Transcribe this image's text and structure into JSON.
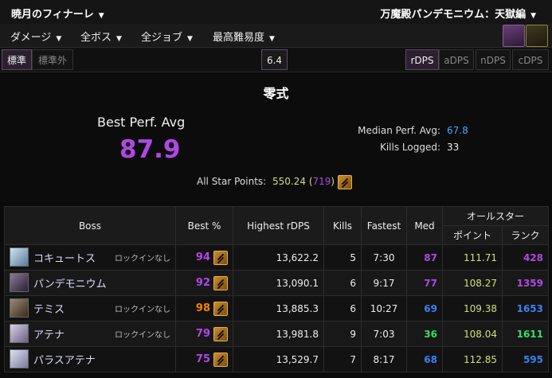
{
  "header": {
    "character": "暁月のフィナーレ",
    "zone": "万魔殿パンデモニウム：天獄編"
  },
  "filters": {
    "metric": "ダメージ",
    "boss": "全ボス",
    "job": "全ジョブ",
    "difficulty": "最高難易度"
  },
  "tabs": {
    "partition": [
      {
        "label": "標準",
        "active": true
      },
      {
        "label": "標準外",
        "active": false
      }
    ],
    "patch": "6.4",
    "dps_types": [
      {
        "label": "rDPS",
        "active": true
      },
      {
        "label": "aDPS",
        "active": false
      },
      {
        "label": "nDPS",
        "active": false
      },
      {
        "label": "cDPS",
        "active": false
      }
    ]
  },
  "summary": {
    "difficulty_name": "零式",
    "best_perf_label": "Best Perf. Avg",
    "best_perf_value": "87.9",
    "median_label": "Median Perf. Avg:",
    "median_value": "67.8",
    "kills_label": "Kills Logged:",
    "kills_value": "33",
    "allstar_label": "All Star Points:",
    "allstar_points": "550.24",
    "allstar_rank": "719"
  },
  "table": {
    "headers": {
      "boss": "Boss",
      "best": "Best %",
      "highest": "Highest rDPS",
      "kills": "Kills",
      "fastest": "Fastest",
      "med": "Med",
      "allstar": "オールスター",
      "point": "ポイント",
      "rank": "ランク"
    },
    "rows": [
      {
        "name": "コキュートス",
        "lockin": "ロックインなし",
        "best": "94",
        "best_color": "#b147e6",
        "rdps": "13,622.2",
        "kills": "5",
        "fastest": "7:30",
        "med": "87",
        "med_color": "#b147e6",
        "points": "111.71",
        "rank": "428",
        "rank_color": "#b147e6"
      },
      {
        "name": "パンデモニウム",
        "lockin": "",
        "best": "92",
        "best_color": "#b147e6",
        "rdps": "13,090.1",
        "kills": "6",
        "fastest": "9:17",
        "med": "77",
        "med_color": "#b147e6",
        "points": "108.27",
        "rank": "1359",
        "rank_color": "#b147e6"
      },
      {
        "name": "テミス",
        "lockin": "ロックインなし",
        "best": "98",
        "best_color": "#ff8000",
        "rdps": "13,885.3",
        "kills": "6",
        "fastest": "10:27",
        "med": "69",
        "med_color": "#3b82f6",
        "points": "109.38",
        "rank": "1653",
        "rank_color": "#3b82f6"
      },
      {
        "name": "アテナ",
        "lockin": "ロックインなし",
        "best": "79",
        "best_color": "#b147e6",
        "rdps": "13,981.8",
        "kills": "9",
        "fastest": "7:03",
        "med": "36",
        "med_color": "#32e06a",
        "points": "108.04",
        "rank": "1611",
        "rank_color": "#32e06a"
      },
      {
        "name": "パラスアテナ",
        "lockin": "",
        "best": "75",
        "best_color": "#b147e6",
        "rdps": "13,529.7",
        "kills": "7",
        "fastest": "8:17",
        "med": "68",
        "med_color": "#3b82f6",
        "points": "112.85",
        "rank": "595",
        "rank_color": "#3b82f6"
      }
    ]
  }
}
